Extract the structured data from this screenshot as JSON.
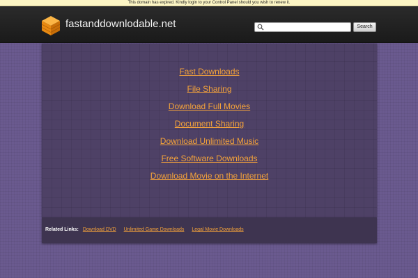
{
  "notice": {
    "text": "This domain has expired. Kindly login to your Control Panel should you wish to renew it."
  },
  "header": {
    "site_name": "fastanddownlodable.net",
    "logo_icon": "cube-logo-icon",
    "search": {
      "value": "",
      "placeholder": "",
      "button_label": "Search"
    }
  },
  "colors": {
    "background": "#6a5a8f",
    "panel": "#4e4166",
    "footer": "#3e3450",
    "header": "#1f1f1f",
    "link": "#f5a33a",
    "logo": "#f39a1e"
  },
  "main": {
    "links": [
      "Fast Downloads",
      "File Sharing",
      "Download Full Movies",
      "Document Sharing",
      "Download Unlimited Music",
      "Free Software Downloads",
      "Download Movie on the Internet"
    ]
  },
  "footer": {
    "related_label": "Related Links:",
    "related_links": [
      "Download DVD",
      "Unlimited Game Downloads",
      "Legal Movie Downloads"
    ]
  }
}
